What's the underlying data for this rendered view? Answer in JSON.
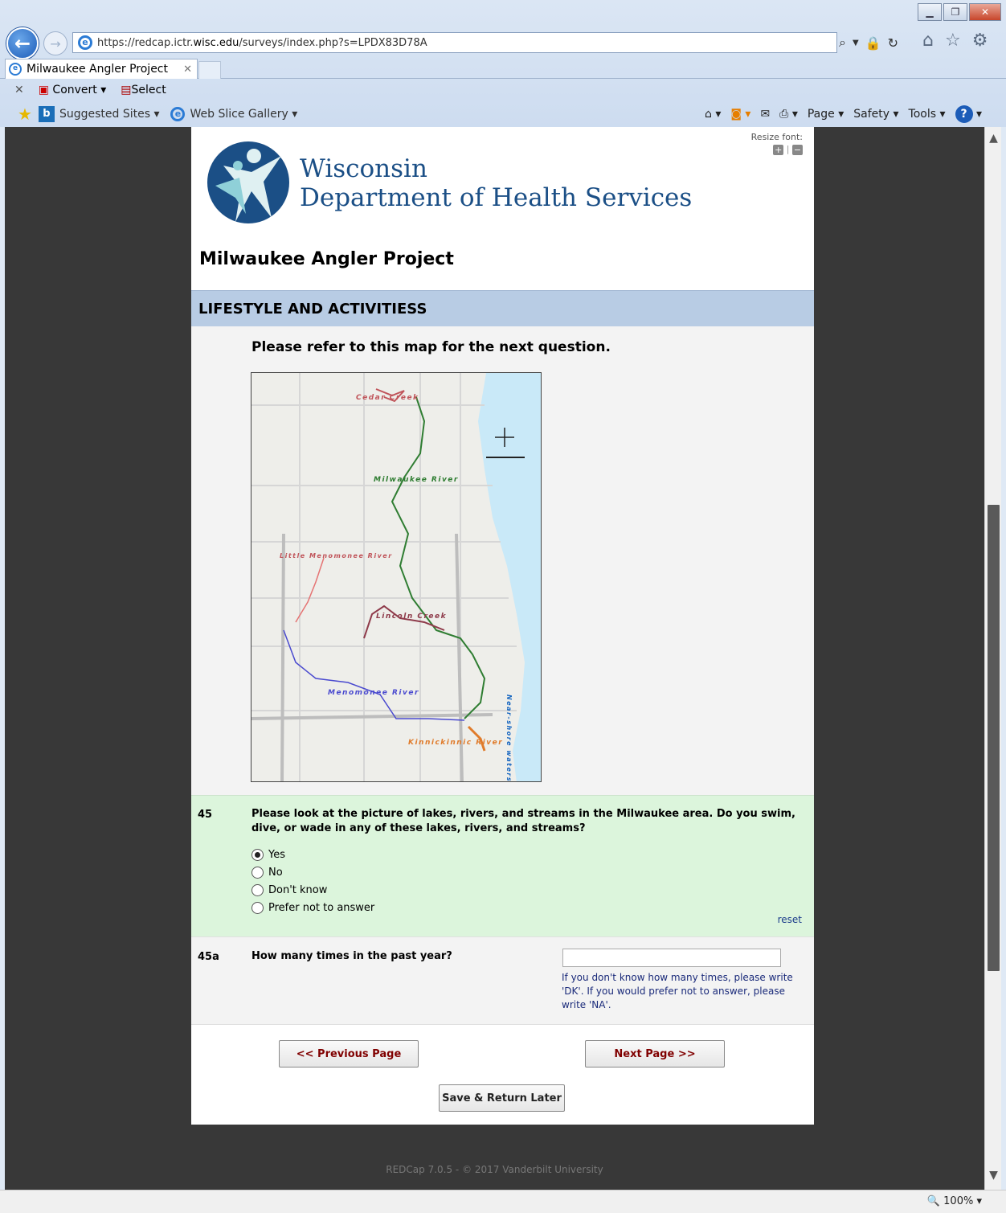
{
  "browser": {
    "url_domain_prefix": "https://redcap.ictr.",
    "url_domain": "wisc.edu",
    "url_rest": "/surveys/index.php?s=LPDX83D78A",
    "tab_title": "Milwaukee Angler Project",
    "cmd_convert": "Convert",
    "cmd_select": "Select",
    "fav_suggested": "Suggested Sites",
    "fav_webslice": "Web Slice Gallery",
    "tool_page": "Page",
    "tool_safety": "Safety",
    "tool_tools": "Tools",
    "zoom": "100%"
  },
  "header": {
    "resize_label": "Resize font:",
    "org_line1": "Wisconsin",
    "org_line2": "Department of Health Services",
    "project_title": "Milwaukee Angler Project"
  },
  "section": {
    "title": "LIFESTYLE AND ACTIVITIESS"
  },
  "map": {
    "caption": "Please refer to this map for the next question.",
    "labels": {
      "cedar": "Cedar Creek",
      "milwaukee": "Milwaukee River",
      "little": "Little Menomonee River",
      "lincoln": "Lincoln Creek",
      "menomonee": "Menomonee River",
      "kinnickinnic": "Kinnickinnic River",
      "lake": "Near-shore waters of Lake Michigan"
    }
  },
  "questions": {
    "q45": {
      "number": "45",
      "text": "Please look at the picture of lakes, rivers, and streams in the Milwaukee area. Do you swim, dive, or wade in any of these lakes, rivers, and streams?",
      "options": [
        "Yes",
        "No",
        "Don't know",
        "Prefer not to answer"
      ],
      "selected": "Yes",
      "reset": "reset"
    },
    "q45a": {
      "number": "45a",
      "text": "How many times in the past year?",
      "value": "",
      "note": "If you don't know how many times, please write 'DK'. If you would prefer not to answer, please write 'NA'."
    }
  },
  "buttons": {
    "prev": "<< Previous Page",
    "next": "Next Page >>",
    "save": "Save & Return Later"
  },
  "footer": "REDCap 7.0.5 - © 2017 Vanderbilt University"
}
